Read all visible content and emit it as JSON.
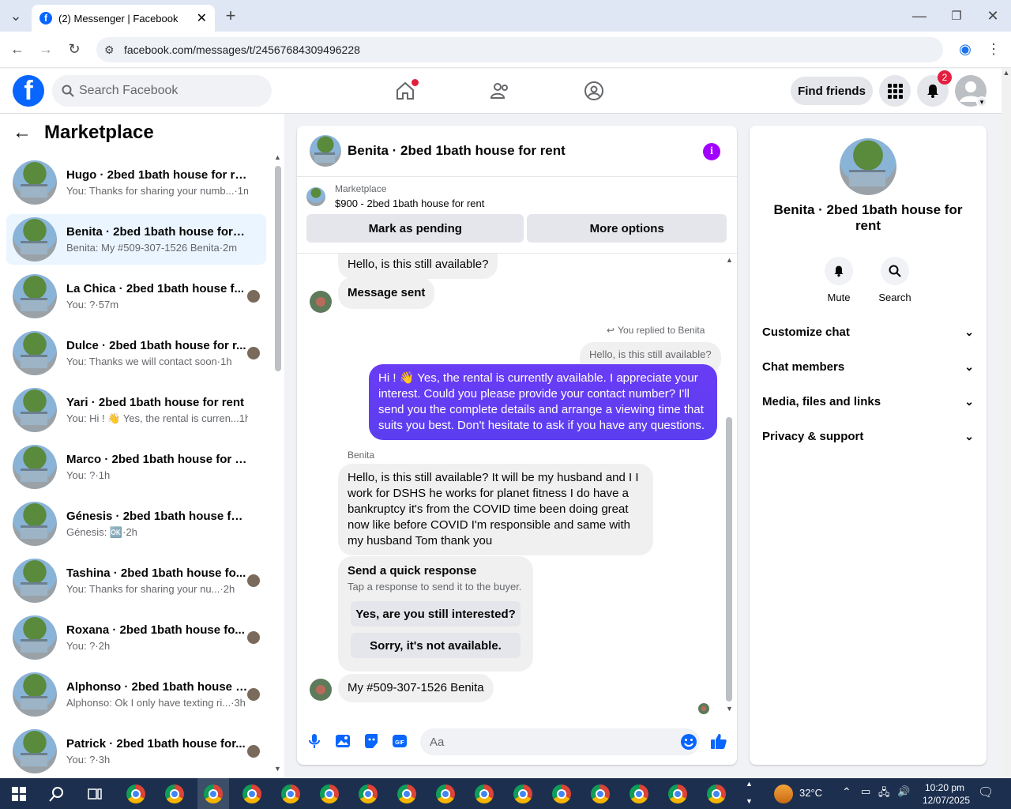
{
  "browser": {
    "tab_title": "(2) Messenger | Facebook",
    "url": "facebook.com/messages/t/24567684309496228"
  },
  "header": {
    "search_placeholder": "Search Facebook",
    "find_friends": "Find friends",
    "notification_count": "2"
  },
  "left": {
    "title": "Marketplace",
    "conversations": [
      {
        "name": "Hugo · 2bed 1bath house for rent",
        "preview": "You: Thanks for sharing your numb...",
        "time": "·1m",
        "active": false
      },
      {
        "name": "Benita · 2bed 1bath house for rent",
        "preview": "Benita: My #509-307-1526 Benita",
        "time": "·2m",
        "active": true
      },
      {
        "name": "La Chica · 2bed 1bath house f...",
        "preview": "You: ?",
        "time": "·57m"
      },
      {
        "name": "Dulce · 2bed 1bath house for r...",
        "preview": "You: Thanks we will contact soon",
        "time": "·1h"
      },
      {
        "name": "Yari · 2bed 1bath house for rent",
        "preview": "You: Hi ! 👋 Yes, the rental is curren...",
        "time": "1h"
      },
      {
        "name": "Marco · 2bed 1bath house for rent",
        "preview": "You: ?",
        "time": "·1h"
      },
      {
        "name": "Génesis · 2bed 1bath house for r...",
        "preview": "Génesis: 🆗",
        "time": "·2h"
      },
      {
        "name": "Tashina · 2bed 1bath house fo...",
        "preview": "You: Thanks for sharing your nu...",
        "time": "·2h"
      },
      {
        "name": "Roxana · 2bed 1bath house fo...",
        "preview": "You: ?",
        "time": "·2h"
      },
      {
        "name": "Alphonso · 2bed 1bath house fo...",
        "preview": "Alphonso: Ok I only have texting ri...",
        "time": "·3h"
      },
      {
        "name": "Patrick · 2bed 1bath house for...",
        "preview": "You: ?",
        "time": "·3h"
      }
    ]
  },
  "chat": {
    "title": "Benita · 2bed 1bath house for rent",
    "listing_source": "Marketplace",
    "listing": "$900 - 2bed 1bath house for rent",
    "mark_pending": "Mark as pending",
    "more_options": "More options",
    "msg1": "Hello, is this still available?",
    "msg2": "Message sent",
    "replied_label": "You replied to Benita",
    "replied_quote": "Hello, is this still available?",
    "msg_out": "Hi ! 👋 Yes, the rental is currently available. I appreciate your interest. Could you please provide your contact number? I'll send you the complete details and arrange a viewing time that suits you best. Don't hesitate to ask if you have any questions.",
    "sender_name": "Benita",
    "msg_in": "Hello, is this still available? It will be my husband and I I work for DSHS he works for planet fitness I do have a bankruptcy it's from the COVID time been doing great now like before COVID I'm responsible and same with my husband Tom thank you",
    "quick_title": "Send a quick response",
    "quick_sub": "Tap a response to send it to the buyer.",
    "quick_1": "Yes, are you still interested?",
    "quick_2": "Sorry, it's not available.",
    "msg_last": "My #509-307-1526 Benita",
    "input_placeholder": "Aa"
  },
  "right": {
    "title": "Benita · 2bed 1bath house for rent",
    "mute": "Mute",
    "search": "Search",
    "sections": [
      "Customize chat",
      "Chat members",
      "Media, files and links",
      "Privacy & support"
    ]
  },
  "taskbar": {
    "temperature": "32°C",
    "time": "10:20 pm",
    "date": "12/07/2025"
  }
}
